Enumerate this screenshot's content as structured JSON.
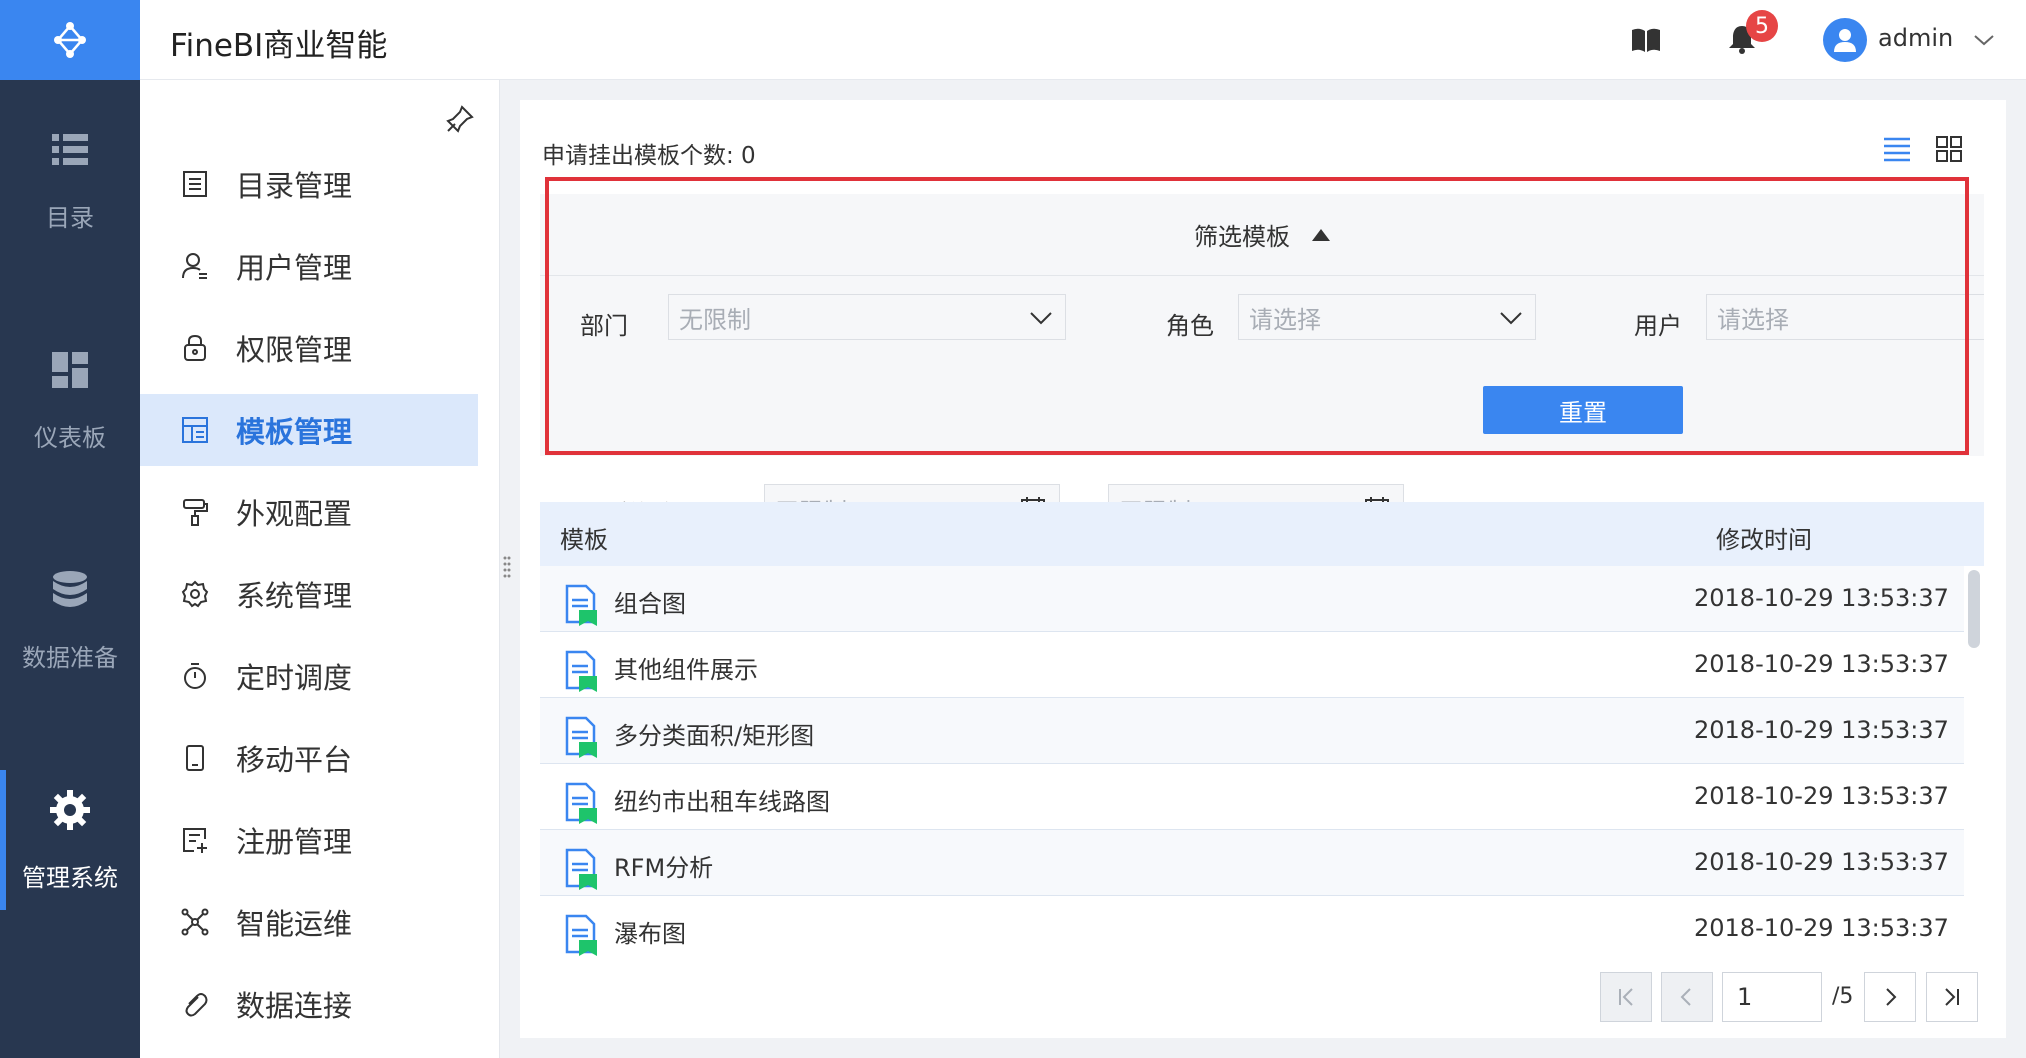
{
  "app": {
    "title": "FineBI商业智能"
  },
  "header": {
    "notification_count": "5",
    "user_name": "admin"
  },
  "rail": [
    {
      "label": "目录",
      "icon": "list-icon"
    },
    {
      "label": "仪表板",
      "icon": "dashboard-icon"
    },
    {
      "label": "数据准备",
      "icon": "database-icon"
    },
    {
      "label": "管理系统",
      "icon": "gear-icon",
      "active": true
    }
  ],
  "subnav": [
    {
      "label": "目录管理",
      "icon": "catalog-icon"
    },
    {
      "label": "用户管理",
      "icon": "user-icon"
    },
    {
      "label": "权限管理",
      "icon": "lock-icon"
    },
    {
      "label": "模板管理",
      "icon": "template-icon",
      "active": true
    },
    {
      "label": "外观配置",
      "icon": "paint-roller-icon"
    },
    {
      "label": "系统管理",
      "icon": "settings-icon"
    },
    {
      "label": "定时调度",
      "icon": "timer-icon"
    },
    {
      "label": "移动平台",
      "icon": "mobile-icon"
    },
    {
      "label": "注册管理",
      "icon": "register-icon"
    },
    {
      "label": "智能运维",
      "icon": "network-icon"
    },
    {
      "label": "数据连接",
      "icon": "link-icon"
    }
  ],
  "main": {
    "count_text": "申请挂出模板个数: 0",
    "filter": {
      "title": "筛选模板",
      "dept_label": "部门",
      "dept_value": "无限制",
      "role_label": "角色",
      "role_placeholder": "请选择",
      "user_label": "用户",
      "user_placeholder": "请选择",
      "date_label": "最近修改日期",
      "date_from": "无限制",
      "date_sep": "-",
      "date_to": "无限制",
      "reset_label": "重置"
    },
    "table": {
      "columns": [
        "模板",
        "修改时间"
      ],
      "rows": [
        {
          "name": "组合图",
          "time": "2018-10-29 13:53:37"
        },
        {
          "name": "其他组件展示",
          "time": "2018-10-29 13:53:37"
        },
        {
          "name": "多分类面积/矩形图",
          "time": "2018-10-29 13:53:37"
        },
        {
          "name": "纽约市出租车线路图",
          "time": "2018-10-29 13:53:37"
        },
        {
          "name": "RFM分析",
          "time": "2018-10-29 13:53:37"
        },
        {
          "name": "瀑布图",
          "time": "2018-10-29 13:53:37"
        }
      ]
    },
    "pager": {
      "current": "1",
      "total": "/5"
    }
  },
  "colors": {
    "accent": "#3a86f0",
    "rail_bg": "#283750",
    "highlight": "#e0323a",
    "badge": "#e64545"
  }
}
